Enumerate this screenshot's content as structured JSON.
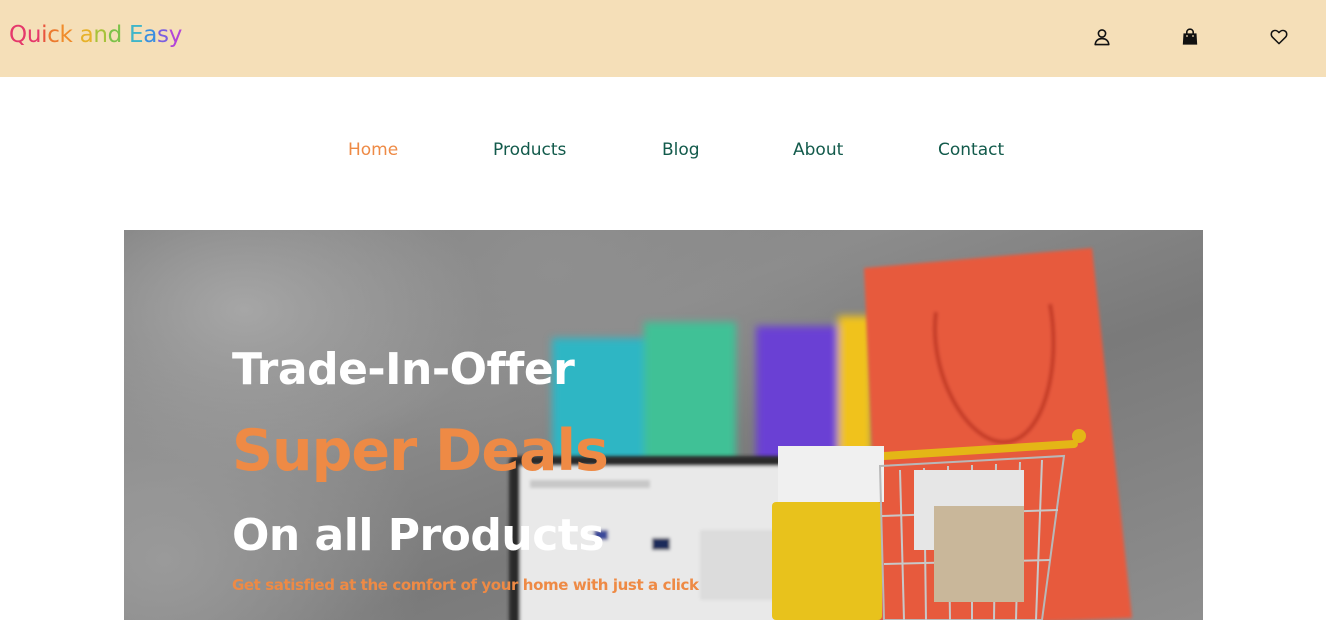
{
  "header": {
    "logo_letters": [
      {
        "ch": "Q",
        "color": "#e5386b"
      },
      {
        "ch": "u",
        "color": "#e5386b"
      },
      {
        "ch": "i",
        "color": "#e8553e"
      },
      {
        "ch": "c",
        "color": "#ec7a2e"
      },
      {
        "ch": "k",
        "color": "#f08c2c"
      },
      {
        "ch": " ",
        "color": "#ffffff"
      },
      {
        "ch": "a",
        "color": "#e7b22a"
      },
      {
        "ch": "n",
        "color": "#a7c23a"
      },
      {
        "ch": "d",
        "color": "#7cc24a"
      },
      {
        "ch": " ",
        "color": "#ffffff"
      },
      {
        "ch": "E",
        "color": "#3fb5c9"
      },
      {
        "ch": "a",
        "color": "#3b8fe0"
      },
      {
        "ch": "s",
        "color": "#7b5fe0"
      },
      {
        "ch": "y",
        "color": "#b244d8"
      }
    ],
    "icons": {
      "account": "user-icon",
      "cart": "shopping-bag-icon",
      "wishlist": "heart-icon"
    }
  },
  "nav": {
    "home": "Home",
    "products": "Products",
    "blog": "Blog",
    "about": "About",
    "contact": "Contact"
  },
  "hero": {
    "title": "Trade-In-Offer",
    "highlight": "Super Deals",
    "subtitle": "On all Products",
    "tagline": "Get satisfied at the comfort of your home with just a click"
  },
  "colors": {
    "topbar_bg": "#f5dfb8",
    "nav_text": "#125a4b",
    "accent": "#ee8a45"
  }
}
